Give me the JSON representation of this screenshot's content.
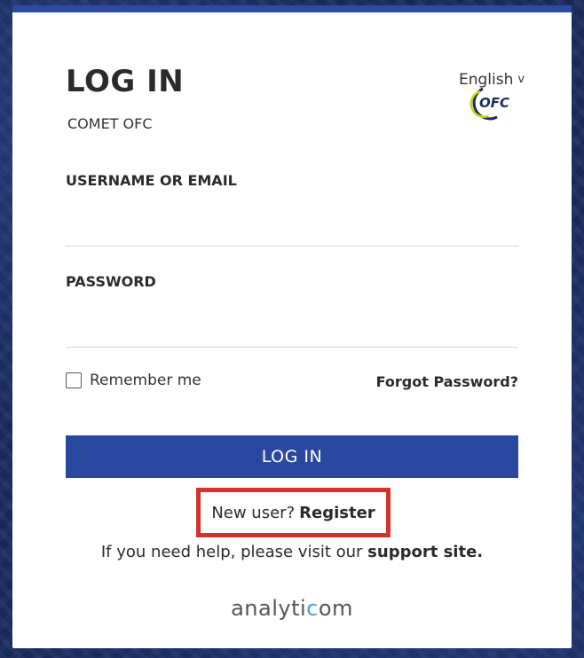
{
  "page": {
    "title": "LOG IN",
    "subtitle": "COMET OFC"
  },
  "language": {
    "selected": "English",
    "chevron": "v"
  },
  "logo": {
    "text": "OFC"
  },
  "form": {
    "username_label": "USERNAME OR EMAIL",
    "username_value": "",
    "password_label": "PASSWORD",
    "password_value": "",
    "remember_label": "Remember me",
    "remember_checked": false,
    "forgot_label": "Forgot Password?",
    "submit_label": "LOG IN"
  },
  "register": {
    "prompt": "New user?",
    "link_label": "Register"
  },
  "help": {
    "prefix": "If you need help, please visit our",
    "link_label": "support site."
  },
  "brand": {
    "text_part1": "analyti",
    "text_part2": "c",
    "text_part3": "om"
  },
  "colors": {
    "accent": "#2b48a1",
    "highlight": "#d0342c",
    "background": "#1a2b5e"
  }
}
